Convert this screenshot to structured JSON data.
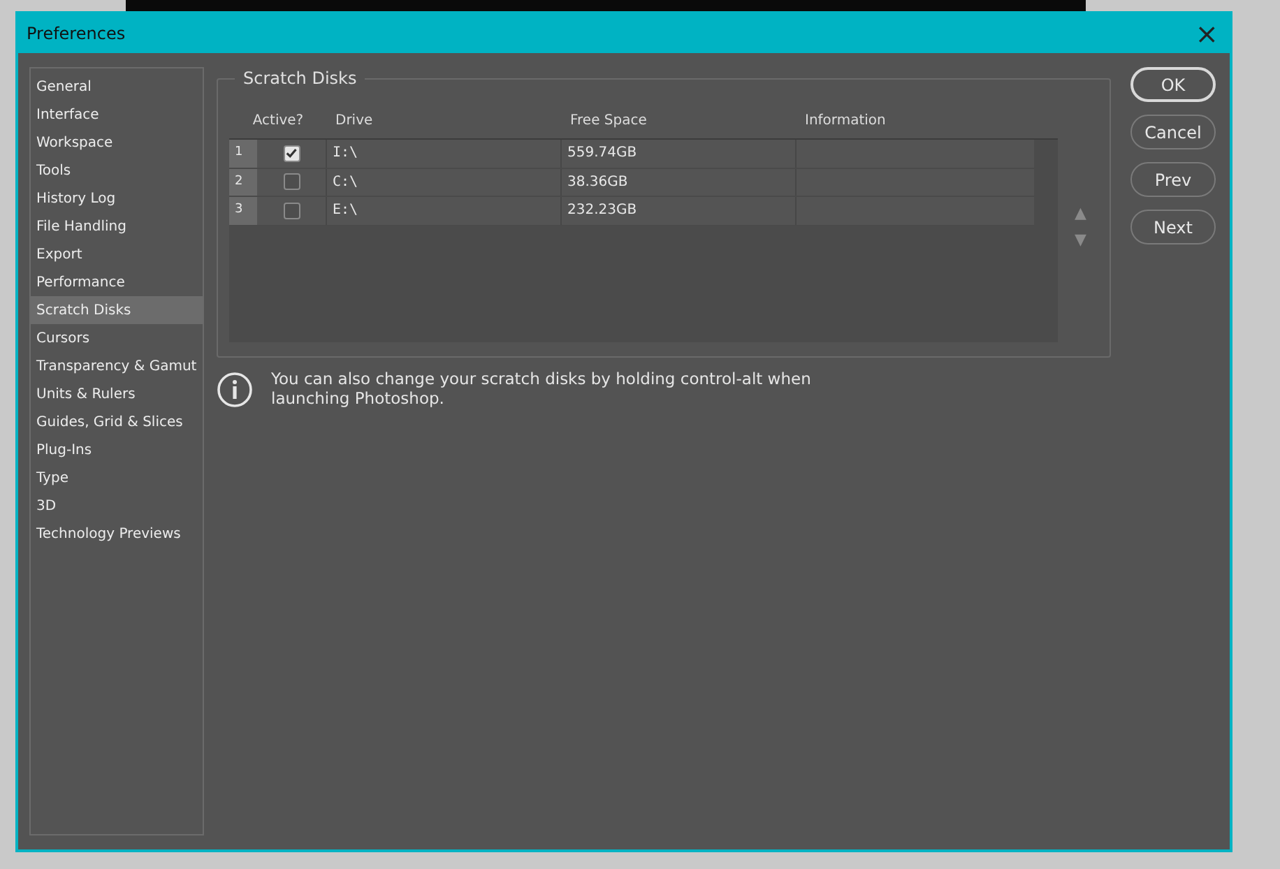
{
  "window": {
    "title": "Preferences",
    "close": "×"
  },
  "sidebar": {
    "items": [
      {
        "label": "General",
        "selected": false
      },
      {
        "label": "Interface",
        "selected": false
      },
      {
        "label": "Workspace",
        "selected": false
      },
      {
        "label": "Tools",
        "selected": false
      },
      {
        "label": "History Log",
        "selected": false
      },
      {
        "label": "File Handling",
        "selected": false
      },
      {
        "label": "Export",
        "selected": false
      },
      {
        "label": "Performance",
        "selected": false
      },
      {
        "label": "Scratch Disks",
        "selected": true
      },
      {
        "label": "Cursors",
        "selected": false
      },
      {
        "label": "Transparency & Gamut",
        "selected": false
      },
      {
        "label": "Units & Rulers",
        "selected": false
      },
      {
        "label": "Guides, Grid & Slices",
        "selected": false
      },
      {
        "label": "Plug-Ins",
        "selected": false
      },
      {
        "label": "Type",
        "selected": false
      },
      {
        "label": "3D",
        "selected": false
      },
      {
        "label": "Technology Previews",
        "selected": false
      }
    ]
  },
  "scratch_disks": {
    "title": "Scratch Disks",
    "columns": [
      "Active?",
      "Drive",
      "Free Space",
      "Information"
    ],
    "rows": [
      {
        "number": "1",
        "active": true,
        "drive": "I:\\",
        "free_space": "559.74GB"
      },
      {
        "number": "2",
        "active": false,
        "drive": "C:\\",
        "free_space": "38.36GB"
      },
      {
        "number": "3",
        "active": false,
        "drive": "E:\\",
        "free_space": "232.23GB"
      }
    ],
    "move_up": "▲",
    "move_down": "▼"
  },
  "info": "You can also change your scratch disks by holding control-alt when launching Photoshop.",
  "buttons": [
    {
      "label": "OK",
      "kind": "default"
    },
    {
      "label": "Cancel",
      "kind": "normal"
    },
    {
      "label": "Prev",
      "kind": "normal"
    },
    {
      "label": "Next",
      "kind": "normal"
    }
  ]
}
